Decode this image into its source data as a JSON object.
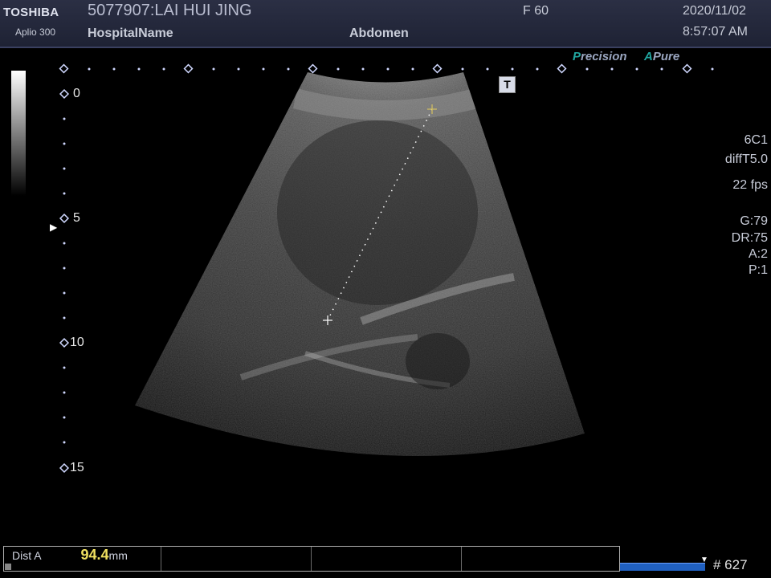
{
  "header": {
    "brand": "TOSHIBA",
    "model": "Aplio 300",
    "patient": "5077907:LAI HUI JING",
    "hospital": "HospitalName",
    "preset": "Abdomen",
    "frame_rate_label": "F  60",
    "date": "2020/11/02",
    "time": "8:57:07 AM"
  },
  "badges": {
    "precision_first": "P",
    "precision_rest": "recision",
    "apure_first": "A",
    "apure_rest": "Pure"
  },
  "params": {
    "probe": "6C1",
    "mode": "diffT5.0",
    "fps": "22 fps",
    "gain": "G:79",
    "dynamic_range": "DR:75",
    "a": "A:2",
    "p": "P:1"
  },
  "depth_scale": {
    "labels": [
      "0",
      "5",
      "10",
      "15"
    ],
    "focus_marker": "▶"
  },
  "overlay_icon": "T",
  "measurement": {
    "label": "Dist A",
    "value": "94.4",
    "unit": "mm"
  },
  "cine": {
    "frame_count": "# 627",
    "marker": "▼"
  },
  "colors": {
    "header_bg": "#23273a",
    "accent_teal": "#21a6a0",
    "measurement_value": "#f0e060",
    "caliper": "#d4c060",
    "cine_bar": "#2060c0"
  },
  "icons": {
    "t_icon": "text-annotation-icon",
    "cursor_marker": "triangle-right-icon",
    "caliper_start": "crosshair-icon",
    "caliper_end": "crosshair-icon"
  }
}
